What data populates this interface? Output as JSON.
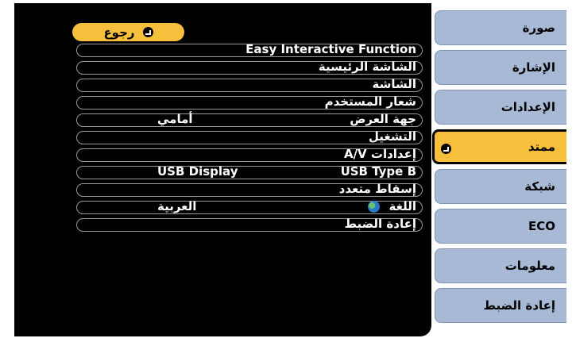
{
  "back_button": {
    "label": "رجوع"
  },
  "rows": [
    {
      "label": "Easy Interactive Function",
      "value": ""
    },
    {
      "label": "الشاشة الرئيسية",
      "value": ""
    },
    {
      "label": "الشاشة",
      "value": ""
    },
    {
      "label": "شعار المستخدم",
      "value": ""
    },
    {
      "label": "جهة العرض",
      "value": "أمامي"
    },
    {
      "label": "التشغيل",
      "value": ""
    },
    {
      "label": "إعدادات A/V",
      "value": ""
    },
    {
      "label": "USB Type B",
      "value": "USB Display"
    },
    {
      "label": "إسقاط متعدد",
      "value": ""
    },
    {
      "label": "اللغة",
      "value": "العربية",
      "icon": "globe-icon"
    },
    {
      "label": "إعادة الضبط",
      "value": ""
    }
  ],
  "sidebar": {
    "items": [
      {
        "label": "صورة"
      },
      {
        "label": "الإشارة"
      },
      {
        "label": "الإعدادات"
      },
      {
        "label": "ممتد",
        "active": true,
        "icon": "enter-icon"
      },
      {
        "label": "شبكة"
      },
      {
        "label": "ECO"
      },
      {
        "label": "معلومات"
      },
      {
        "label": "إعادة الضبط"
      }
    ]
  },
  "colors": {
    "accent": "#f6bf3c",
    "tab": "#a7b9d4",
    "panel": "#000000"
  }
}
